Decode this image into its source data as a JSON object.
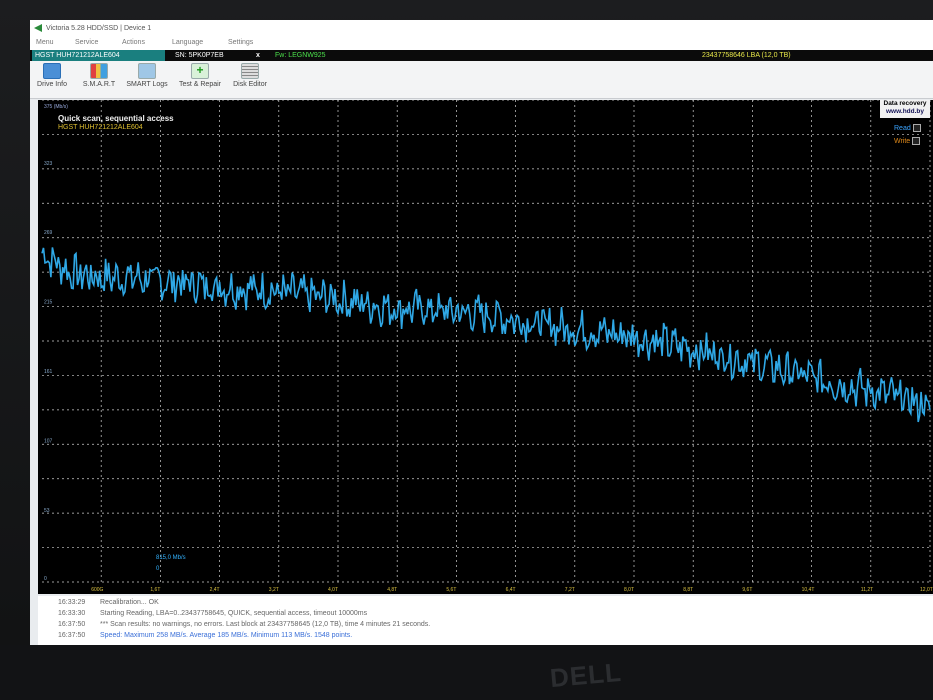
{
  "window": {
    "title": "Victoria 5.28 HDD/SSD | Device 1"
  },
  "menu": [
    "Menu",
    "Service",
    "Actions",
    "Language",
    "Settings"
  ],
  "drive": {
    "model": "HGST HUH721212ALE604",
    "serial": "SN: 5PK0P7EB",
    "close": "x",
    "firmware": "Fw: LEGNW925",
    "capacity": "23437758646 LBA (12,0 TB)"
  },
  "toolbar": [
    {
      "label": "Drive Info",
      "icon": "info-icon"
    },
    {
      "label": "S.M.A.R.T",
      "icon": "smart-chart-icon"
    },
    {
      "label": "SMART Logs",
      "icon": "logs-icon"
    },
    {
      "label": "Test & Repair",
      "icon": "plus-icon"
    },
    {
      "label": "Disk Editor",
      "icon": "disk-editor-icon"
    }
  ],
  "chart": {
    "heading": "Quick scan, sequential access",
    "model": "HGST HUH721212ALE604",
    "unit": "375 (Mb/s)",
    "badge_line1": "Data recovery",
    "badge_line2": "www.hdd.by",
    "legend": [
      {
        "label": "Read",
        "color": "#3aa3ff"
      },
      {
        "label": "Write",
        "color": "#e08a1a"
      }
    ],
    "speed_label": "815,0 Mb/s",
    "speed_zero": "0",
    "colors": {
      "trace": "#2fa8e6",
      "grid": "#cfcfcf",
      "background": "#000000"
    }
  },
  "chart_data": {
    "type": "line",
    "ylim": [
      0,
      375
    ],
    "y_tick_labels": [
      "323",
      "269",
      "215",
      "161",
      "107",
      "53",
      "0"
    ],
    "x_tick_labels": [
      "0",
      "600G",
      "1,6T",
      "2,4T",
      "3,2T",
      "4,0T",
      "4,8T",
      "5,6T",
      "6,4T",
      "7,2T",
      "8,0T",
      "8,8T",
      "9,6T",
      "10,4T",
      "11,2T",
      "12,0T"
    ],
    "xlim_tb": [
      0,
      12.0
    ],
    "series": [
      {
        "name": "Read",
        "x": [
          0,
          0.4,
          0.8,
          1.2,
          1.6,
          2.0,
          2.4,
          2.8,
          3.2,
          3.6,
          4.0,
          4.4,
          4.8,
          5.2,
          5.6,
          6.0,
          6.4,
          6.8,
          7.2,
          7.6,
          8.0,
          8.4,
          8.8,
          9.2,
          9.6,
          10.0,
          10.4,
          10.8,
          11.2,
          11.6,
          12.0
        ],
        "y": [
          256,
          240,
          237,
          237,
          234,
          232,
          230,
          228,
          226,
          223,
          220,
          216,
          213,
          212,
          210,
          208,
          204,
          200,
          197,
          194,
          191,
          186,
          181,
          176,
          171,
          165,
          159,
          154,
          149,
          143,
          136
        ]
      }
    ],
    "grid": true
  },
  "log": [
    {
      "time": "16:33:29",
      "msg": "Recalibration... OK"
    },
    {
      "time": "16:33:30",
      "msg": "Starting Reading, LBA=0..23437758645, QUICK, sequential access, timeout 10000ms"
    },
    {
      "time": "16:37:50",
      "msg": "*** Scan results: no warnings, no errors. Last block at 23437758645 (12,0 TB), time 4 minutes 21 seconds."
    },
    {
      "time": "16:37:50",
      "msg": "Speed: Maximum 258 MB/s. Average 185 MB/s. Minimum 113 MB/s. 1548 points."
    }
  ],
  "bezel": {
    "logo": "DELL"
  }
}
